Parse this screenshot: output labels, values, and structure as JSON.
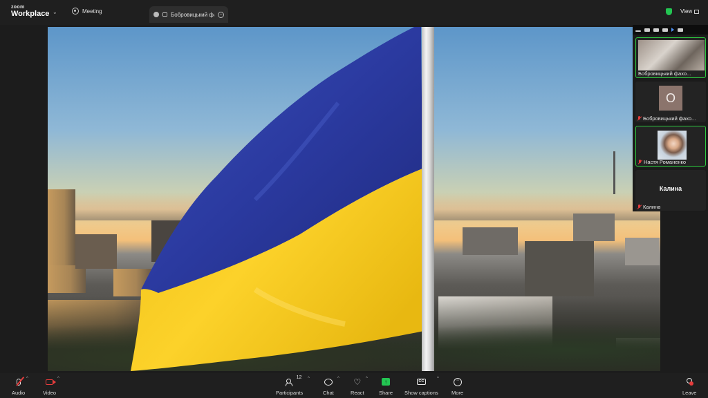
{
  "app": {
    "brand_top": "zoom",
    "brand_bottom": "Workplace",
    "accent_green": "#23c552",
    "muted_red": "#e63c3c"
  },
  "topbar": {
    "meeting_label": "Meeting",
    "share_tab_title": "Бобровицький фа...",
    "view_label": "View"
  },
  "participants_panel": {
    "tiles": [
      {
        "name": "Бобровицький фахо...",
        "video": "room",
        "active": true,
        "muted": false
      },
      {
        "name": "Бобровицький фахо...",
        "avatar_letter": "О",
        "video": "avatar",
        "active": false,
        "muted": true
      },
      {
        "name": "Настя Романенко",
        "video": "person",
        "active": true,
        "muted": true
      },
      {
        "name": "Калина",
        "display_name": "Калина",
        "video": "none",
        "active": false,
        "muted": true
      }
    ]
  },
  "toolbar": {
    "audio": "Audio",
    "video": "Video",
    "participants": "Participants",
    "participants_count": "12",
    "chat": "Chat",
    "react": "React",
    "share": "Share",
    "captions": "Show captions",
    "more": "More",
    "leave": "Leave",
    "cc_glyph": "CC",
    "more_glyph": "···",
    "share_glyph": "↑"
  }
}
